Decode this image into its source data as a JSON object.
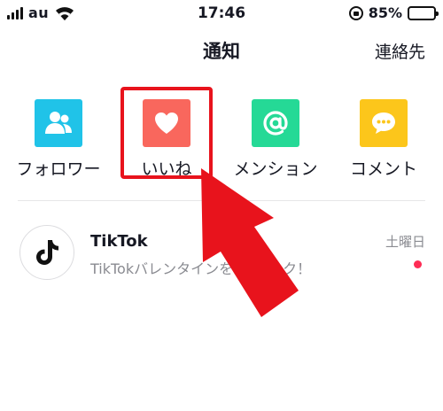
{
  "status_bar": {
    "carrier": "au",
    "time": "17:46",
    "battery_percent": "85%",
    "battery_level": 0.85,
    "icons": [
      "signal-icon",
      "wifi-icon",
      "rotation-lock-icon",
      "battery-icon"
    ]
  },
  "header": {
    "title": "通知",
    "contacts_label": "連絡先"
  },
  "categories": [
    {
      "label": "フォロワー",
      "icon": "followers-icon",
      "color": "#20c3e8"
    },
    {
      "label": "いいね",
      "icon": "heart-icon",
      "color": "#f9675d"
    },
    {
      "label": "メンション",
      "icon": "at-sign-icon",
      "color": "#25d996"
    },
    {
      "label": "コメント",
      "icon": "comment-icon",
      "color": "#fcc61b"
    }
  ],
  "notifications": [
    {
      "title": "TikTok",
      "preview": "TikTokバレンタインを",
      "preview_tail": "ク！",
      "date": "土曜日",
      "unread": true,
      "icon": "tiktok-logo-icon"
    }
  ],
  "colors": {
    "highlight": "#e8131c",
    "arrow": "#e8131c",
    "unread_dot": "#fe2c55",
    "battery_fill": "#4cd964"
  }
}
